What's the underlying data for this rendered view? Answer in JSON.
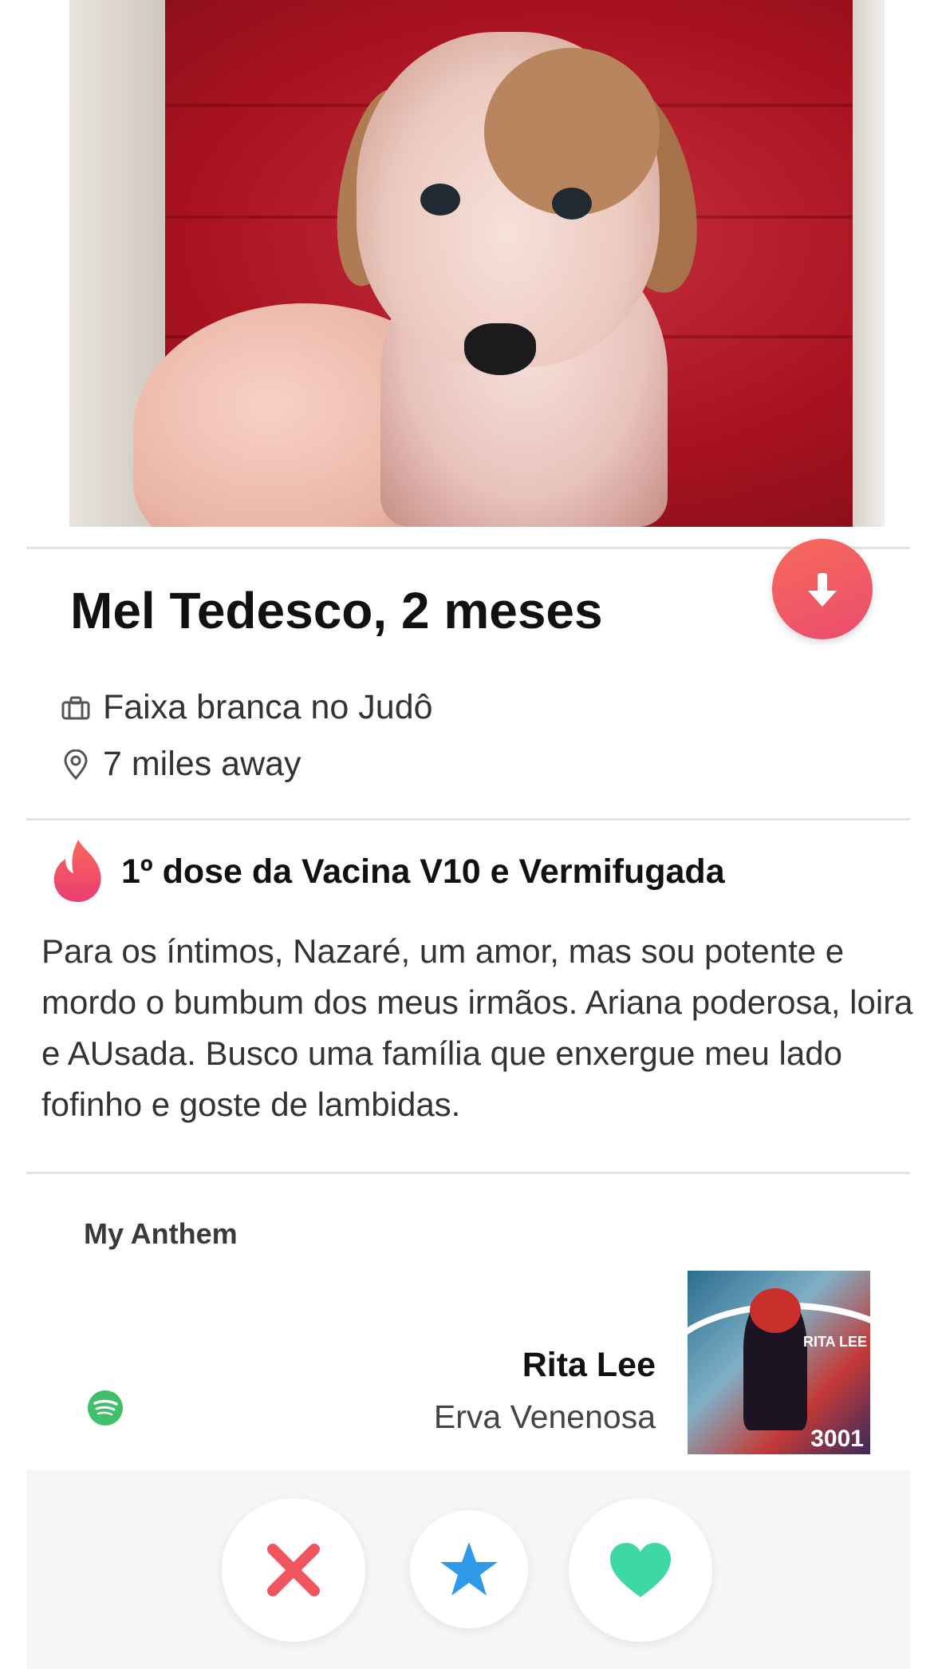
{
  "profile": {
    "name_age": "Mel Tedesco, 2 meses",
    "job": "Faixa branca no Judô",
    "distance": "7 miles away"
  },
  "icons": {
    "job": "briefcase-icon",
    "distance": "location-pin-icon",
    "vaccine": "tinder-flame-icon",
    "expand": "arrow-down-icon",
    "music": "spotify-icon"
  },
  "highlight": {
    "title": "1º dose da Vacina V10 e Vermifugada"
  },
  "bio": "Para os íntimos, Nazaré, um amor, mas sou potente e mordo o bumbum dos meus irmãos. Ariana poderosa, loira e AUsada. Busco uma família que enxergue meu lado fofinho e goste de lambidas.",
  "anthem": {
    "label": "My Anthem",
    "artist": "Rita Lee",
    "song": "Erva Venenosa",
    "album_art_text_top": "RITA LEE",
    "album_art_text_bottom": "3001"
  },
  "actions": {
    "nope": "close-icon",
    "super_like": "star-icon",
    "like": "heart-icon"
  },
  "colors": {
    "brand_gradient_start": "#f76a5a",
    "brand_gradient_end": "#ea4d6f",
    "nope": "#f0545d",
    "super_like": "#2f9be8",
    "like": "#3ed8a6",
    "spotify": "#3fbf6a"
  }
}
